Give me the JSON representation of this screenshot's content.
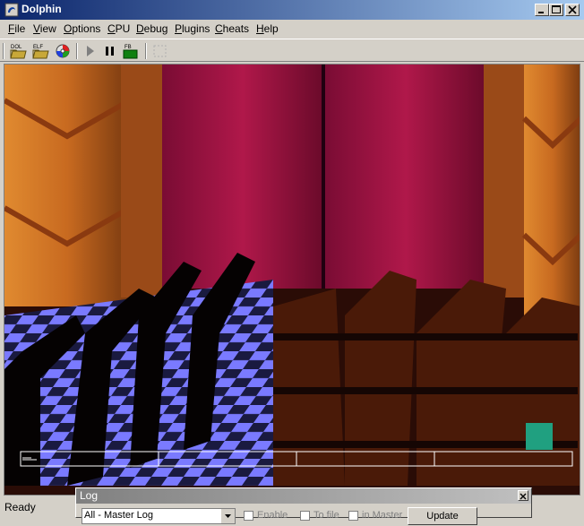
{
  "window": {
    "title": "Dolphin"
  },
  "menu": [
    "File",
    "View",
    "Options",
    "CPU",
    "Debug",
    "Plugins",
    "Cheats",
    "Help"
  ],
  "menu_underline": [
    "F",
    "V",
    "O",
    "C",
    "D",
    "P",
    "C",
    "H"
  ],
  "toolbar": {
    "dol_label": "DOL",
    "elf_label": "ELF",
    "fb_label": "FB"
  },
  "status": {
    "text": "Ready"
  },
  "log": {
    "title": "Log",
    "selected_source": "All - Master Log",
    "enable_label": "Enable",
    "to_file_label": "To file",
    "in_master_label": "in Master",
    "update_label": "Update"
  },
  "colors": {
    "titlebar": "#0a246a",
    "curtain": "#9c1040",
    "checker": "#7a7aff"
  }
}
